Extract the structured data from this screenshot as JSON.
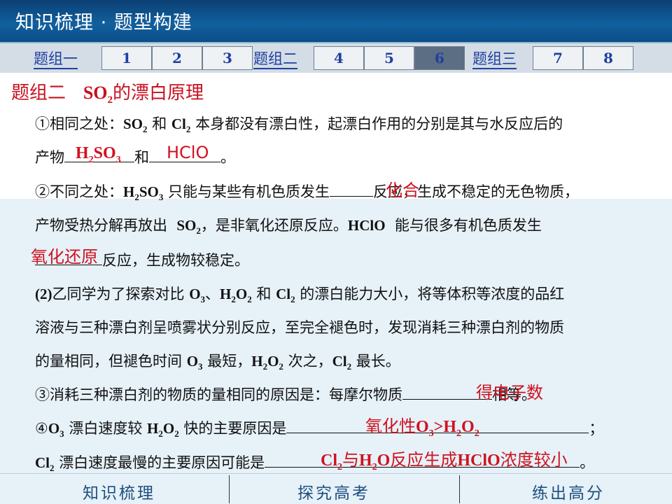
{
  "header": {
    "title": "知识梳理 · 题型构建"
  },
  "tabbar": {
    "groups": [
      "题组一",
      "题组二",
      "题组三"
    ],
    "tabs": [
      "1",
      "2",
      "3",
      "4",
      "5",
      "6",
      "7",
      "8"
    ],
    "active_tab": "6"
  },
  "content": {
    "section_title_prefix": "题组二",
    "section_title_so": "SO",
    "section_title_sub": "2",
    "section_title_suffix": "的漂白原理",
    "l1_a": "①相同之处：",
    "l1_b": "和",
    "l1_c": "本身都没有漂白性，起漂白作用的分别是其与水反应后的",
    "l2_a": "产物",
    "l2_b": "和",
    "l2_c": "。",
    "l3_a": "②不同之处：",
    "l3_b": "只能与某些有机色质发生",
    "l3_c": "反应，生成不稳定的无色物质，",
    "l4_a": "产物受热分解再放出",
    "l4_b": "，是非氧化还原反应。",
    "l4_c": "能与很多有机色质发生",
    "l5_a": "反应，生成物较稳定。",
    "l6_a": "(2)",
    "l6_b": "乙同学为了探索对比",
    "l6_c": "、",
    "l6_d": "和",
    "l6_e": "的漂白能力大小，将等体积等浓度的品红",
    "l7": "溶液与三种漂白剂呈喷雾状分别反应，至完全褪色时，发现消耗三种漂白剂的物质",
    "l8_a": "的量相同，但褪色时间",
    "l8_b": "最短，",
    "l8_c": "次之，",
    "l8_d": "最长。",
    "l9_a": "③消耗三种漂白剂的物质的量相同的原因是：每摩尔物质",
    "l9_b": "相等。",
    "l10_a": "④",
    "l10_b": "漂白速度较",
    "l10_c": "快的主要原因是",
    "l10_d": "；",
    "l11_a": "漂白速度最慢的主要原因可能是",
    "l11_b": "。"
  },
  "answers": {
    "a1": "H2SO3",
    "a2": "HClO",
    "a3": "化合",
    "a4": "氧化还原",
    "a5": "得电子数",
    "a6": "氧化性O3>H2O2",
    "a7": "Cl2与H2O反应生成HClO浓度较小"
  },
  "footer": {
    "items": [
      "知识梳理",
      "探究高考",
      "练出高分"
    ]
  },
  "colors": {
    "header": "#11609e",
    "accent_red": "#c8101e",
    "tab_text": "#1f3fa0",
    "active_tab_bg": "#5c6e84"
  }
}
